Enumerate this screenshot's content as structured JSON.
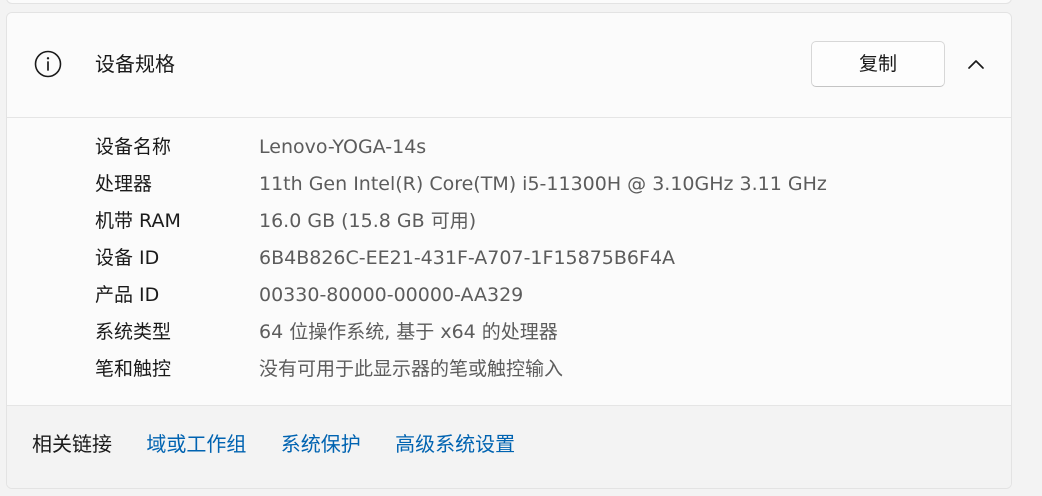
{
  "header": {
    "icon": "info-icon",
    "title": "设备规格",
    "copy_label": "复制",
    "collapse_icon": "chevron-up-icon"
  },
  "specs": [
    {
      "label": "设备名称",
      "value": "Lenovo-YOGA-14s"
    },
    {
      "label": "处理器",
      "value": "11th Gen Intel(R) Core(TM) i5-11300H @ 3.10GHz   3.11 GHz"
    },
    {
      "label": "机带 RAM",
      "value": "16.0 GB (15.8 GB 可用)"
    },
    {
      "label": "设备 ID",
      "value": "6B4B826C-EE21-431F-A707-1F15875B6F4A"
    },
    {
      "label": "产品 ID",
      "value": "00330-80000-00000-AA329"
    },
    {
      "label": "系统类型",
      "value": "64 位操作系统, 基于 x64 的处理器"
    },
    {
      "label": "笔和触控",
      "value": "没有可用于此显示器的笔或触控输入"
    }
  ],
  "footer": {
    "label": "相关链接",
    "links": [
      "域或工作组",
      "系统保护",
      "高级系统设置"
    ]
  },
  "colors": {
    "link": "#0063b1",
    "value_text": "#5c5c5c",
    "card_bg": "#fbfbfb",
    "page_bg": "#f3f3f3"
  }
}
